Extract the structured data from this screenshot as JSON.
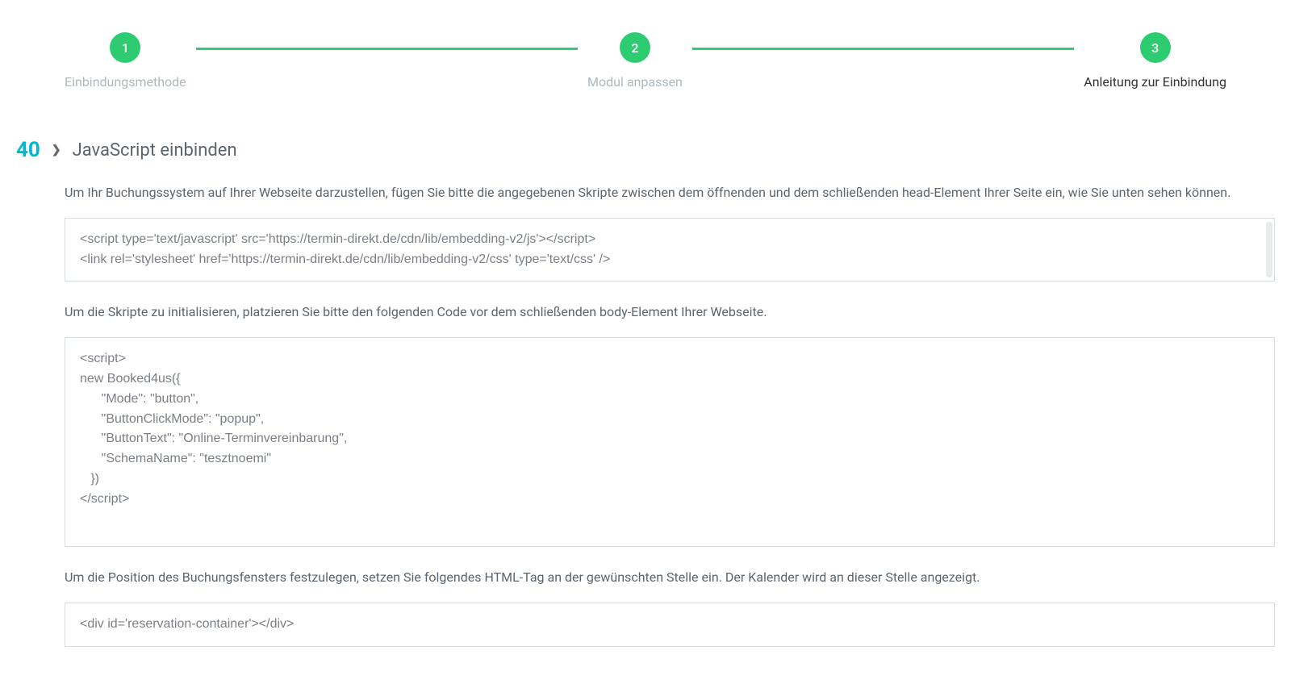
{
  "stepper": {
    "steps": [
      {
        "num": "1",
        "label": "Einbindungsmethode"
      },
      {
        "num": "2",
        "label": "Modul anpassen"
      },
      {
        "num": "3",
        "label": "Anleitung zur Einbindung"
      }
    ]
  },
  "section": {
    "number": "40",
    "title": "JavaScript einbinden"
  },
  "para1": "Um Ihr Buchungssystem auf Ihrer Webseite darzustellen, fügen Sie bitte die angegebenen Skripte zwischen dem öffnenden und dem schließenden head-Element Ihrer Seite ein, wie Sie unten sehen können.",
  "code1": "<script type='text/javascript' src='https://termin-direkt.de/cdn/lib/embedding-v2/js'></script>\n<link rel='stylesheet' href='https://termin-direkt.de/cdn/lib/embedding-v2/css' type='text/css' />",
  "para2": "Um die Skripte zu initialisieren, platzieren Sie bitte den folgenden Code vor dem schließenden body-Element Ihrer Webseite.",
  "code2": "<script>\nnew Booked4us({\n      \"Mode\": \"button\",\n      \"ButtonClickMode\": \"popup\",\n      \"ButtonText\": \"Online-Terminvereinbarung\",\n      \"SchemaName\": \"tesztnoemi\"\n   })\n</script>",
  "para3": "Um die Position des Buchungsfensters festzulegen, setzen Sie folgendes HTML-Tag an der gewünschten Stelle ein. Der Kalender wird an dieser Stelle angezeigt.",
  "code3": "<div id='reservation-container'></div>"
}
